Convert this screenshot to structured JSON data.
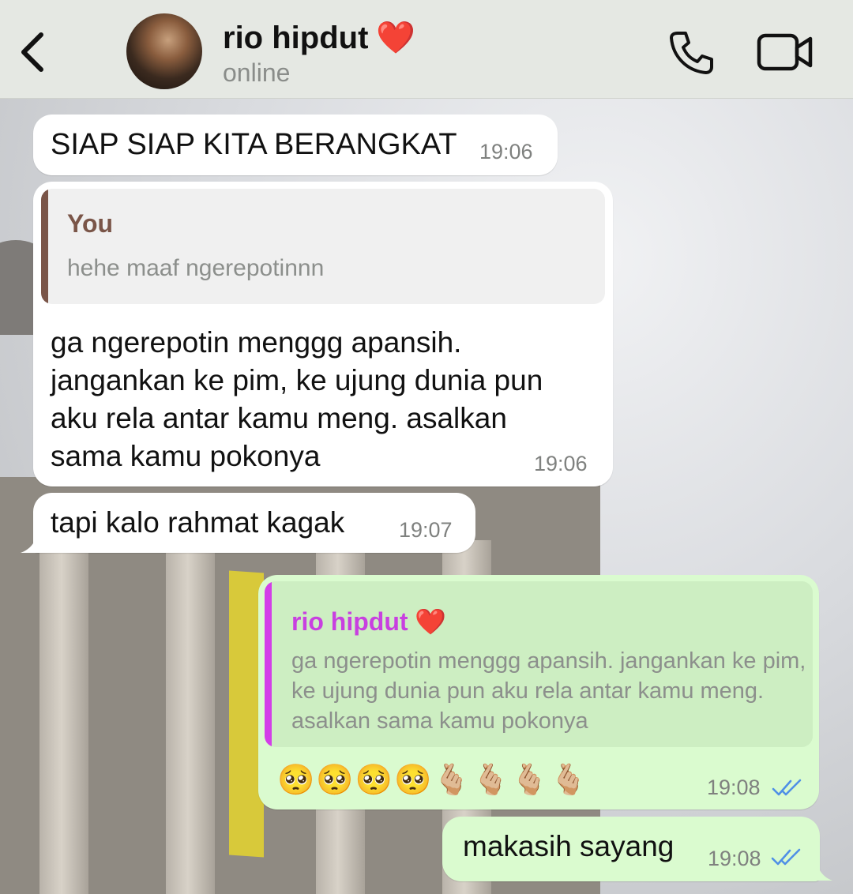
{
  "header": {
    "contact_name": "rio hipdut",
    "heart": "❤️",
    "status": "online"
  },
  "messages": [
    {
      "id": "m1",
      "direction": "incoming",
      "text": "SIAP SIAP KITA BERANGKAT",
      "time": "19:06"
    },
    {
      "id": "m2",
      "direction": "incoming",
      "reply_to": {
        "author": "You",
        "text": "hehe maaf ngerepotinnn"
      },
      "text": "ga ngerepotin menggg apansih.\njangankan ke pim, ke ujung dunia pun\naku rela antar kamu meng. asalkan\nsama kamu pokonya",
      "time": "19:06"
    },
    {
      "id": "m3",
      "direction": "incoming",
      "text": "tapi kalo rahmat kagak",
      "time": "19:07"
    },
    {
      "id": "m4",
      "direction": "outgoing",
      "reply_to": {
        "author": "rio hipdut",
        "heart": "❤️",
        "text": "ga ngerepotin menggg apansih. jangankan\nke pim, ke ujung dunia pun aku rela antar\nkamu meng. asalkan sama kamu pokonya"
      },
      "text": "🥺🥺🥺🥺🫰🏼🫰🏼🫰🏼🫰🏼",
      "time": "19:08",
      "read": true
    },
    {
      "id": "m5",
      "direction": "outgoing",
      "text": "makasih sayang",
      "time": "19:08",
      "read": true
    }
  ],
  "colors": {
    "header_bg": "#e5e8e3",
    "incoming_bubble": "#ffffff",
    "outgoing_bubble": "#dafbcf",
    "quote_you_bar": "#7a5548",
    "quote_contact_bar": "#d33ee8",
    "read_ticks": "#4f8fe6"
  },
  "icons": {
    "back": "chevron-left-icon",
    "call": "phone-icon",
    "video": "video-camera-icon",
    "read_receipt": "double-check-icon"
  }
}
